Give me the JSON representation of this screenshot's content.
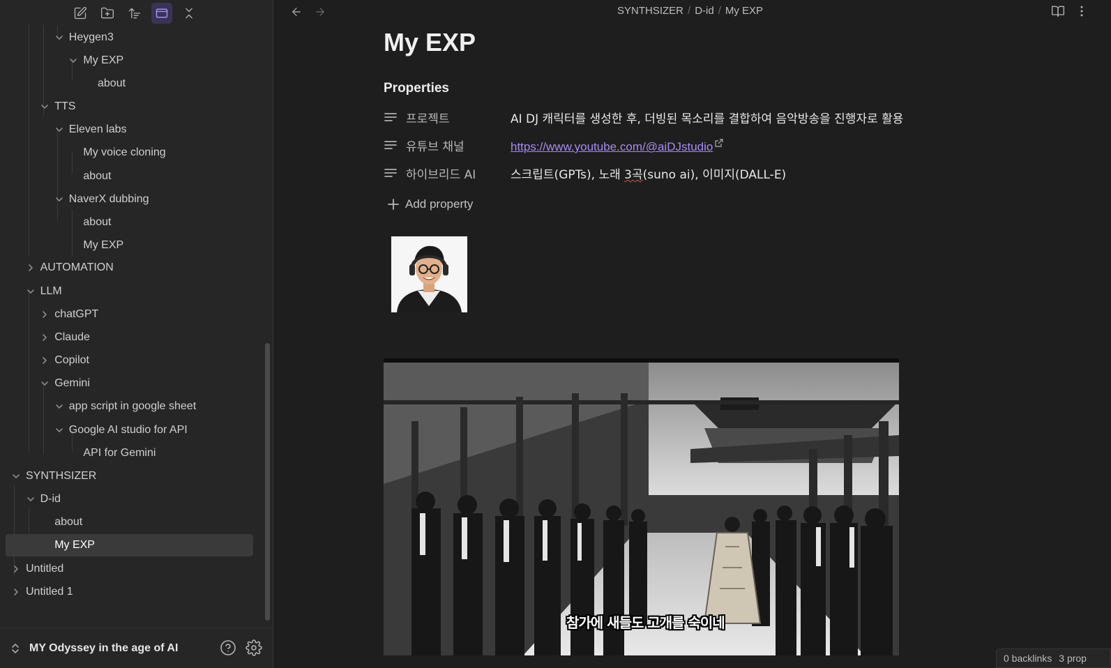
{
  "sidebar": {
    "toolbar": {
      "new_note_icon": "new-note-icon",
      "new_folder_icon": "new-folder-icon",
      "sort_icon": "sort-icon",
      "auto_reveal_icon": "auto-reveal-icon",
      "collapse_all_icon": "collapse-all-icon"
    },
    "tree": [
      {
        "label": "Heygen3",
        "expanded": true
      },
      {
        "label": "My EXP",
        "expanded": true
      },
      {
        "label": "about"
      },
      {
        "label": "TTS",
        "expanded": true
      },
      {
        "label": "Eleven labs",
        "expanded": true
      },
      {
        "label": "My voice cloning"
      },
      {
        "label": "about"
      },
      {
        "label": "NaverX dubbing",
        "expanded": true
      },
      {
        "label": "about"
      },
      {
        "label": "My EXP"
      },
      {
        "label": "AUTOMATION",
        "expanded": false
      },
      {
        "label": "LLM",
        "expanded": true
      },
      {
        "label": "chatGPT",
        "expanded": false
      },
      {
        "label": "Claude",
        "expanded": false
      },
      {
        "label": "Copilot",
        "expanded": false
      },
      {
        "label": "Gemini",
        "expanded": true
      },
      {
        "label": "app script in google sheet",
        "expanded": true
      },
      {
        "label": "Google AI studio for API",
        "expanded": true
      },
      {
        "label": "API for Gemini"
      },
      {
        "label": "SYNTHSIZER",
        "expanded": true
      },
      {
        "label": "D-id",
        "expanded": true
      },
      {
        "label": "about"
      },
      {
        "label": "My EXP",
        "selected": true
      },
      {
        "label": "Untitled",
        "expanded": false
      },
      {
        "label": "Untitled 1",
        "expanded": false
      }
    ],
    "vault": {
      "name": "MY Odyssey in the age of AI",
      "help_icon": "help-icon",
      "settings_icon": "gear-icon"
    }
  },
  "main": {
    "breadcrumb": [
      "SYNTHSIZER",
      "D-id",
      "My EXP"
    ],
    "title": "My EXP",
    "properties": {
      "heading": "Properties",
      "rows": [
        {
          "key": "프로젝트",
          "value": "AI DJ 캐릭터를 생성한 후, 더빙된 목소리를 결합하여 음악방송을 진행자로 활용"
        },
        {
          "key": "유튜브 채널",
          "value": "https://www.youtube.com/@aiDJstudio",
          "is_link": true
        },
        {
          "key": "하이브리드 AI",
          "value_pre": "스크립트(GPTs), 노래 ",
          "value_squiggle": "3곡",
          "value_post": "(suno ai), 이미지(DALL-E)"
        }
      ],
      "add_label": "Add property"
    },
    "hero_caption": "참가에 새들도 고개를 숙이네"
  },
  "status_bar": {
    "backlinks": "0 backlinks",
    "properties": "3 prop"
  },
  "colors": {
    "accent": "#a68bf5",
    "active_button_bg": "#3b3357",
    "background": "#1e1e1e",
    "sidebar_bg": "#262626"
  }
}
